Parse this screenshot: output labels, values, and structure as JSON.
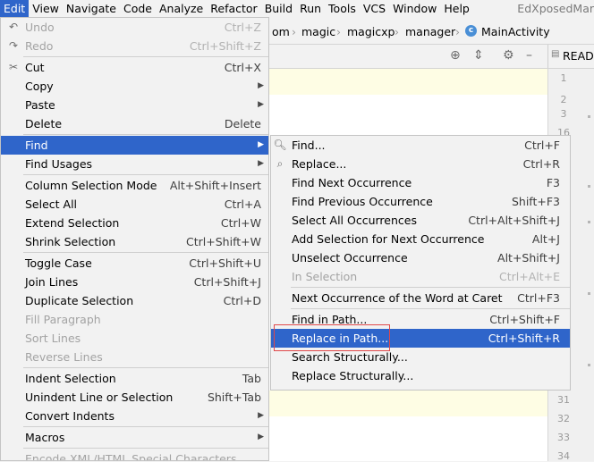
{
  "menubar": {
    "items": [
      "Edit",
      "View",
      "Navigate",
      "Code",
      "Analyze",
      "Refactor",
      "Build",
      "Run",
      "Tools",
      "VCS",
      "Window",
      "Help"
    ],
    "window_title": "EdXposedMar"
  },
  "breadcrumb": {
    "items": [
      "om",
      "magic",
      "magicxp",
      "manager",
      "MainActivity"
    ],
    "class_icon_letter": "c"
  },
  "editor": {
    "readme_tab": "READ",
    "gutter_lines": [
      "1",
      "2",
      "3",
      "16",
      "31",
      "32",
      "33",
      "34"
    ]
  },
  "edit_menu": {
    "items": [
      {
        "label": "Undo",
        "shortcut": "Ctrl+Z",
        "disabled": true,
        "icon": "undo-icon"
      },
      {
        "label": "Redo",
        "shortcut": "Ctrl+Shift+Z",
        "disabled": true,
        "icon": "redo-icon"
      },
      {
        "separator": true
      },
      {
        "label": "Cut",
        "shortcut": "Ctrl+X",
        "icon": "scissors-icon"
      },
      {
        "label": "Copy",
        "submenu": true
      },
      {
        "label": "Paste",
        "submenu": true
      },
      {
        "label": "Delete",
        "shortcut": "Delete"
      },
      {
        "separator": true
      },
      {
        "label": "Find",
        "submenu": true,
        "selected": true
      },
      {
        "label": "Find Usages",
        "submenu": true
      },
      {
        "separator": true
      },
      {
        "label": "Column Selection Mode",
        "shortcut": "Alt+Shift+Insert"
      },
      {
        "label": "Select All",
        "shortcut": "Ctrl+A"
      },
      {
        "label": "Extend Selection",
        "shortcut": "Ctrl+W"
      },
      {
        "label": "Shrink Selection",
        "shortcut": "Ctrl+Shift+W"
      },
      {
        "separator": true
      },
      {
        "label": "Toggle Case",
        "shortcut": "Ctrl+Shift+U"
      },
      {
        "label": "Join Lines",
        "shortcut": "Ctrl+Shift+J"
      },
      {
        "label": "Duplicate Selection",
        "shortcut": "Ctrl+D"
      },
      {
        "label": "Fill Paragraph",
        "disabled": true
      },
      {
        "label": "Sort Lines",
        "disabled": true
      },
      {
        "label": "Reverse Lines",
        "disabled": true
      },
      {
        "separator": true
      },
      {
        "label": "Indent Selection",
        "shortcut": "Tab"
      },
      {
        "label": "Unindent Line or Selection",
        "shortcut": "Shift+Tab"
      },
      {
        "label": "Convert Indents",
        "submenu": true
      },
      {
        "separator": true
      },
      {
        "label": "Macros",
        "submenu": true
      },
      {
        "separator": true
      },
      {
        "label": "Encode XML/HTML Special Characters",
        "disabled": true
      }
    ]
  },
  "find_menu": {
    "items": [
      {
        "label": "Find...",
        "shortcut": "Ctrl+F",
        "icon": "search-icon"
      },
      {
        "label": "Replace...",
        "shortcut": "Ctrl+R",
        "icon": "replace-search-icon"
      },
      {
        "label": "Find Next Occurrence",
        "shortcut": "F3"
      },
      {
        "label": "Find Previous Occurrence",
        "shortcut": "Shift+F3"
      },
      {
        "label": "Select All Occurrences",
        "shortcut": "Ctrl+Alt+Shift+J"
      },
      {
        "label": "Add Selection for Next Occurrence",
        "shortcut": "Alt+J"
      },
      {
        "label": "Unselect Occurrence",
        "shortcut": "Alt+Shift+J"
      },
      {
        "label": "In Selection",
        "shortcut": "Ctrl+Alt+E",
        "disabled": true
      },
      {
        "separator": true
      },
      {
        "label": "Next Occurrence of the Word at Caret",
        "shortcut": "Ctrl+F3"
      },
      {
        "separator": true
      },
      {
        "label": "Find in Path...",
        "shortcut": "Ctrl+Shift+F"
      },
      {
        "label": "Replace in Path...",
        "shortcut": "Ctrl+Shift+R",
        "selected": true
      },
      {
        "label": "Search Structurally..."
      },
      {
        "label": "Replace Structurally..."
      }
    ]
  }
}
